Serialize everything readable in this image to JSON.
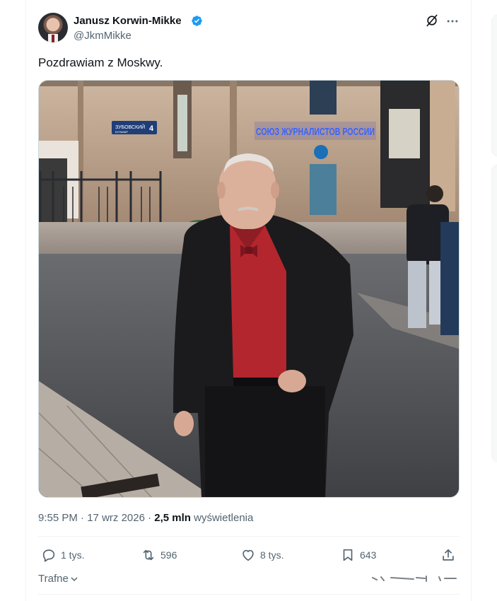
{
  "tweet": {
    "author_name": "Janusz Korwin-Mikke",
    "author_handle": "@JkmMikke",
    "text": "Pozdrawiam z Moskwy.",
    "time": "9:55 PM",
    "date": "17 wrz 2026",
    "views_count": "2,5 mln",
    "views_label": "wyświetlenia",
    "separator": "·"
  },
  "photo": {
    "street_sign": "ЗУБОВСКИЙ",
    "street_sign_sub": "БУЛЬВАР",
    "street_number": "4",
    "building_sign": "СОЮЗ ЖУРНАЛИСТОВ РОССИИ"
  },
  "actions": {
    "replies": "1 tys.",
    "reposts": "596",
    "likes": "8 tys.",
    "bookmarks": "643"
  },
  "sort_label": "Trafne",
  "colors": {
    "verified_badge": "#1d9bf0",
    "text_primary": "#0f1419",
    "text_secondary": "#536471",
    "sign_glow": "#3a63ff"
  }
}
